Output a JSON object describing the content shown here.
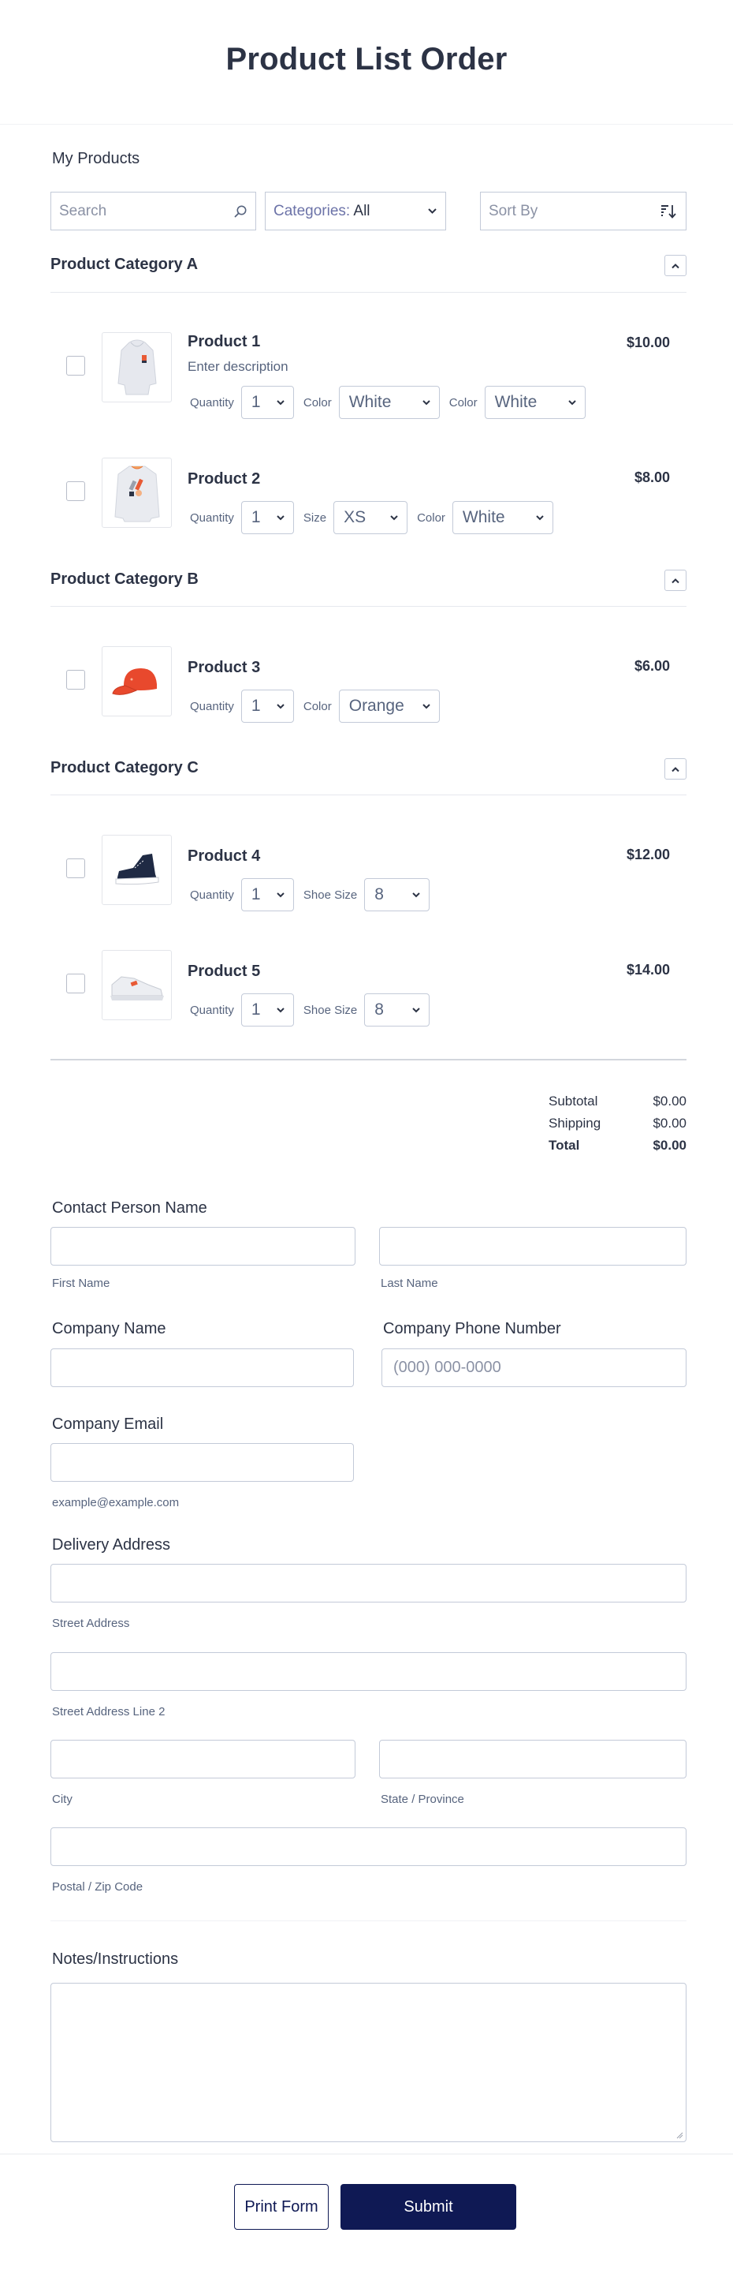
{
  "header": {
    "title": "Product List Order"
  },
  "products_section": {
    "label": "My Products",
    "search": {
      "placeholder": "Search",
      "icon": "search-icon"
    },
    "categories": {
      "label": "Categories:",
      "selected": "All",
      "icon": "chevron-down-icon"
    },
    "sort": {
      "placeholder": "Sort By",
      "icon": "sort-descending-icon"
    }
  },
  "categories": [
    {
      "title": "Product Category A",
      "toggle_icon": "chevron-up-icon",
      "products": [
        {
          "name": "Product 1",
          "description": "Enter description",
          "price": "$10.00",
          "image": "white-hoodie-image",
          "options": [
            {
              "label": "Quantity",
              "value": "1"
            },
            {
              "label": "Color",
              "value": "White"
            },
            {
              "label": "Color",
              "value": "White"
            }
          ]
        },
        {
          "name": "Product 2",
          "price": "$8.00",
          "image": "white-sweatshirt-image",
          "options": [
            {
              "label": "Quantity",
              "value": "1"
            },
            {
              "label": "Size",
              "value": "XS"
            },
            {
              "label": "Color",
              "value": "White"
            }
          ]
        }
      ]
    },
    {
      "title": "Product Category B",
      "toggle_icon": "chevron-up-icon",
      "products": [
        {
          "name": "Product 3",
          "price": "$6.00",
          "image": "orange-cap-image",
          "options": [
            {
              "label": "Quantity",
              "value": "1"
            },
            {
              "label": "Color",
              "value": "Orange"
            }
          ]
        }
      ]
    },
    {
      "title": "Product Category C",
      "toggle_icon": "chevron-up-icon",
      "products": [
        {
          "name": "Product 4",
          "price": "$12.00",
          "image": "navy-high-top-sneaker-image",
          "options": [
            {
              "label": "Quantity",
              "value": "1"
            },
            {
              "label": "Shoe Size",
              "value": "8"
            }
          ]
        },
        {
          "name": "Product 5",
          "price": "$14.00",
          "image": "white-running-shoe-image",
          "options": [
            {
              "label": "Quantity",
              "value": "1"
            },
            {
              "label": "Shoe Size",
              "value": "8"
            }
          ]
        }
      ]
    }
  ],
  "totals": {
    "subtotal_label": "Subtotal",
    "subtotal": "$0.00",
    "shipping_label": "Shipping",
    "shipping": "$0.00",
    "total_label": "Total",
    "total": "$0.00"
  },
  "form": {
    "contact": {
      "label": "Contact Person Name",
      "first_sub": "First Name",
      "last_sub": "Last Name",
      "first_value": "",
      "last_value": ""
    },
    "company_name": {
      "label": "Company Name",
      "value": ""
    },
    "company_phone": {
      "label": "Company Phone Number",
      "placeholder": "(000) 000-0000"
    },
    "company_email": {
      "label": "Company Email",
      "sub": "example@example.com",
      "value": ""
    },
    "address": {
      "label": "Delivery Address",
      "street_sub": "Street Address",
      "street2_sub": "Street Address Line 2",
      "city_sub": "City",
      "state_sub": "State / Province",
      "zip_sub": "Postal / Zip Code"
    },
    "notes": {
      "label": "Notes/Instructions",
      "value": ""
    }
  },
  "actions": {
    "print_label": "Print Form",
    "submit_label": "Submit"
  },
  "colors": {
    "primary": "#0f1954",
    "text": "#2c3345",
    "muted": "#57647e",
    "border": "#c3cad8"
  }
}
